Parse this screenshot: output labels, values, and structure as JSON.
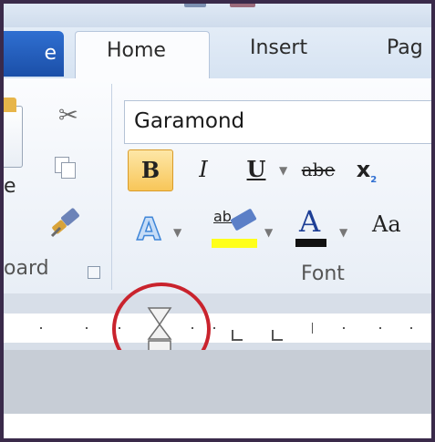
{
  "tabs": {
    "file": "e",
    "home": "Home",
    "insert": "Insert",
    "page": "Pag"
  },
  "clipboard": {
    "paste_label": "e",
    "group_label": "oard"
  },
  "font_group": {
    "font_name": "Garamond",
    "bold": "B",
    "italic": "I",
    "underline": "U",
    "strikethrough": "abe",
    "subscript": "x",
    "subscript_suffix": "2",
    "highlight_text": "ab",
    "font_color_letter": "A",
    "text_effects_letter": "A",
    "change_case": "Aa",
    "group_label": "Font"
  },
  "colors": {
    "accent_highlight": "#ffff1a",
    "font_color": "#111111",
    "annotation_circle": "#c9232d",
    "file_tab": "#2f6fd1"
  }
}
